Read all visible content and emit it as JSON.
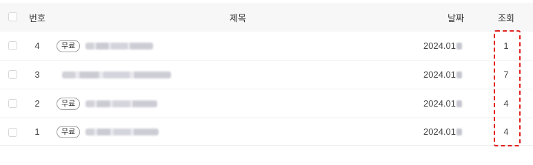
{
  "header": {
    "number_label": "번호",
    "title_label": "제목",
    "date_label": "날짜",
    "views_label": "조회"
  },
  "rows": [
    {
      "number": "4",
      "badge": "무료",
      "date": "2024.01",
      "views": "1"
    },
    {
      "number": "3",
      "badge": "",
      "date": "2024.01",
      "views": "7"
    },
    {
      "number": "2",
      "badge": "무료",
      "date": "2024.01",
      "views": "4"
    },
    {
      "number": "1",
      "badge": "무료",
      "date": "2024.01",
      "views": "4"
    }
  ],
  "colors": {
    "header_bg": "#f7f7f8",
    "highlight": "#e0201c"
  }
}
